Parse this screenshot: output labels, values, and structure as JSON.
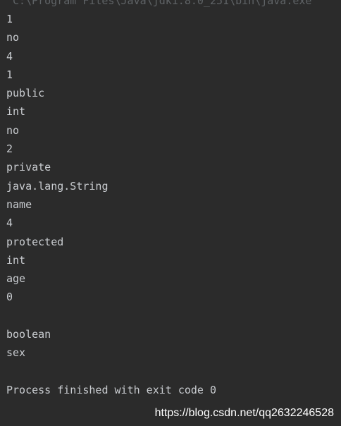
{
  "console": {
    "command": "C:\\Program Files\\Java\\jdk1.8.0_251\\bin\\java.exe",
    "lines": [
      "1",
      "no",
      "4",
      "1",
      "public",
      "int",
      "no",
      "2",
      "private",
      "java.lang.String",
      "name",
      "4",
      "protected",
      "int",
      "age",
      "0",
      "",
      "boolean",
      "sex",
      "",
      "Process finished with exit code 0"
    ]
  },
  "watermark": "https://blog.csdn.net/qq2632246528",
  "colors": {
    "background": "#2b2b2b",
    "text": "#c9ccd0",
    "command_text": "#5f6366"
  }
}
